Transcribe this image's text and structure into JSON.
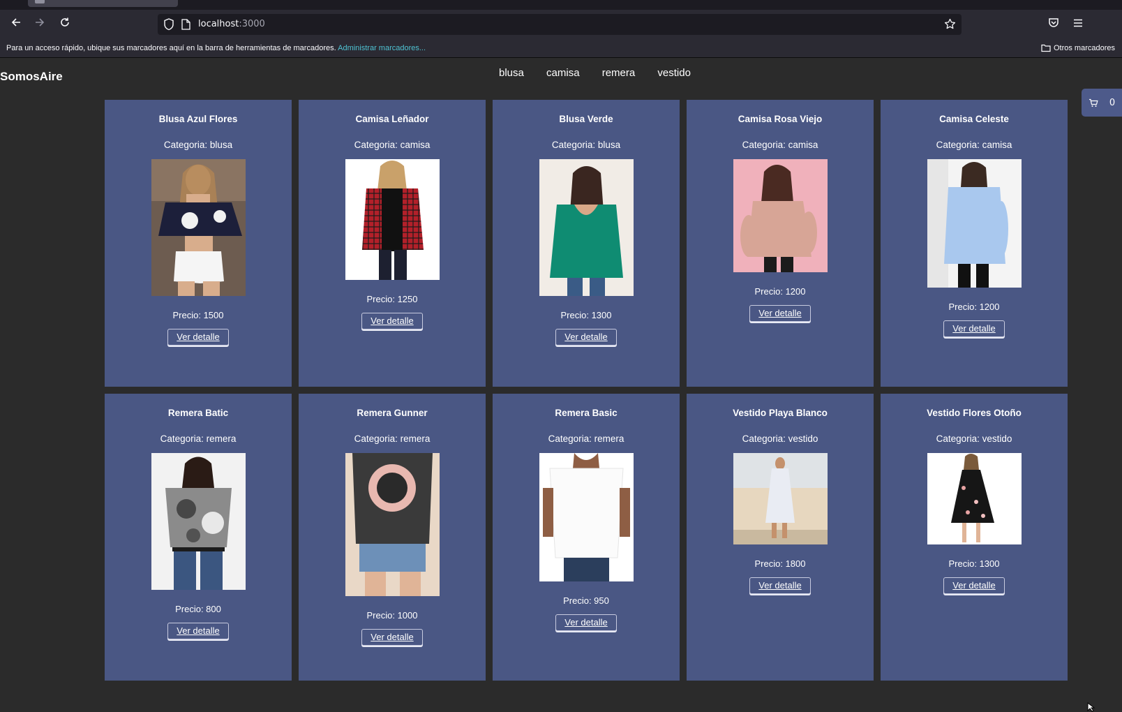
{
  "browser": {
    "url_host": "localhost",
    "url_port": ":3000",
    "bookmarks_hint": "Para un acceso rápido, ubique sus marcadores aquí en la barra de herramientas de marcadores.",
    "bookmarks_link": "Administrar marcadores...",
    "other_bookmarks": "Otros marcadores"
  },
  "header": {
    "brand": "SomosAire",
    "categories": [
      "blusa",
      "camisa",
      "remera",
      "vestido"
    ],
    "cart_count": "0"
  },
  "button_label": "Ver detalle",
  "products": [
    {
      "name": "Blusa Azul Flores",
      "category": "Categoria: blusa",
      "price": "Precio: 1500"
    },
    {
      "name": "Camisa Leñador",
      "category": "Categoria: camisa",
      "price": "Precio: 1250"
    },
    {
      "name": "Blusa Verde",
      "category": "Categoria: blusa",
      "price": "Precio: 1300"
    },
    {
      "name": "Camisa Rosa Viejo",
      "category": "Categoria: camisa",
      "price": "Precio: 1200"
    },
    {
      "name": "Camisa Celeste",
      "category": "Categoria: camisa",
      "price": "Precio: 1200"
    },
    {
      "name": "Remera Batic",
      "category": "Categoria: remera",
      "price": "Precio: 800"
    },
    {
      "name": "Remera Gunner",
      "category": "Categoria: remera",
      "price": "Precio: 1000"
    },
    {
      "name": "Remera Basic",
      "category": "Categoria: remera",
      "price": "Precio: 950"
    },
    {
      "name": "Vestido Playa Blanco",
      "category": "Categoria: vestido",
      "price": "Precio: 1800"
    },
    {
      "name": "Vestido Flores Otoño",
      "category": "Categoria: vestido",
      "price": "Precio: 1300"
    }
  ]
}
